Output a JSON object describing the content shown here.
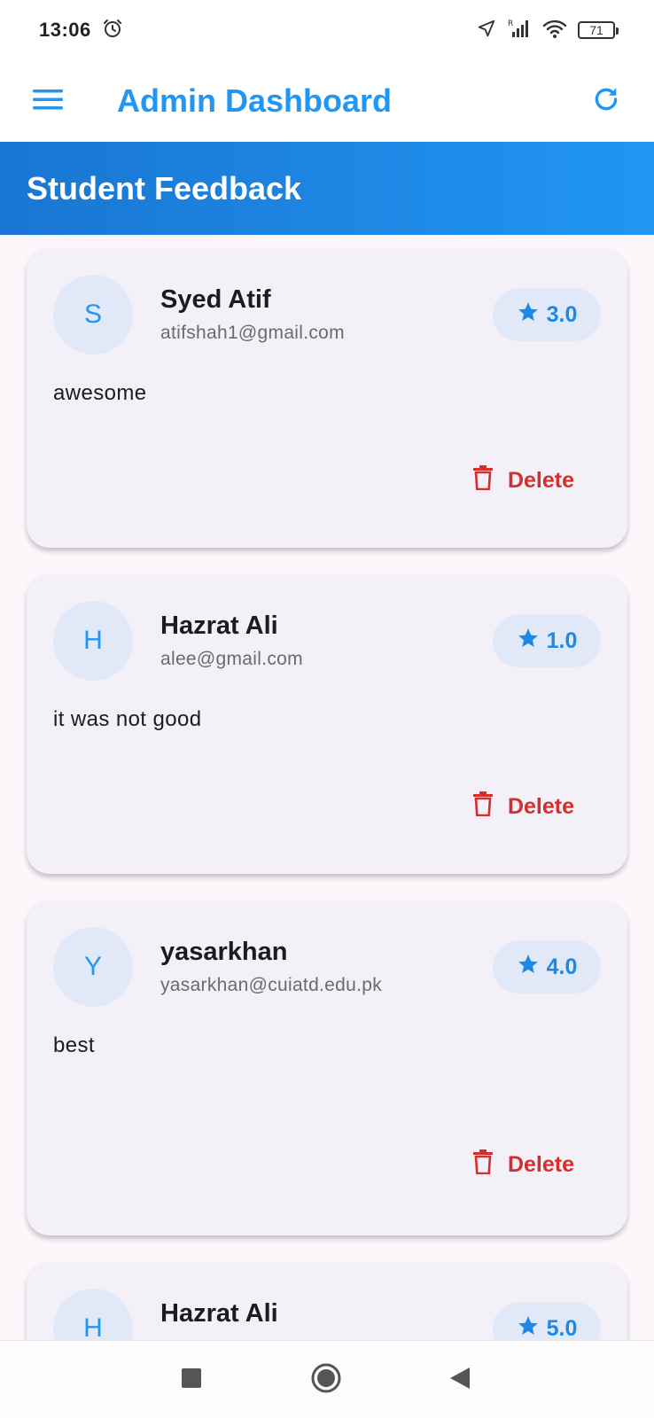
{
  "status_bar": {
    "time": "13:06",
    "battery": "71",
    "icons": [
      "alarm-icon",
      "location-arrow-icon",
      "signal-icon",
      "wifi-icon",
      "battery-icon"
    ]
  },
  "app_bar": {
    "title": "Admin Dashboard",
    "menu_icon": "menu-icon",
    "refresh_icon": "refresh-icon"
  },
  "header": {
    "title": "Student Feedback"
  },
  "colors": {
    "primary": "#2196f3",
    "header_gradient_start": "#1976d2",
    "delete_red": "#d32f2f",
    "card_bg": "#f4f0f7",
    "chip_bg": "#e1e9f8"
  },
  "feedback": [
    {
      "initial": "S",
      "name": "Syed Atif",
      "email": "atifshah1@gmail.com",
      "rating": "3.0",
      "message": "awesome",
      "delete_label": "Delete"
    },
    {
      "initial": "H",
      "name": "Hazrat Ali",
      "email": "alee@gmail.com",
      "rating": "1.0",
      "message": "it was not good",
      "delete_label": "Delete"
    },
    {
      "initial": "Y",
      "name": "yasarkhan",
      "email": "yasarkhan@cuiatd.edu.pk",
      "rating": "4.0",
      "message": "best",
      "delete_label": "Delete"
    },
    {
      "initial": "H",
      "name": "Hazrat Ali",
      "rating": "5.0"
    }
  ],
  "nav_bar": {
    "buttons": [
      "recents-icon",
      "home-icon",
      "back-icon"
    ]
  }
}
